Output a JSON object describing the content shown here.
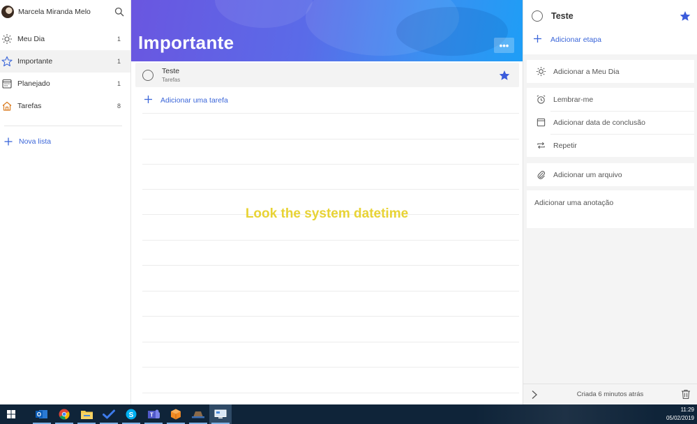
{
  "sidebar": {
    "user_name": "Marcela Miranda Melo",
    "items": [
      {
        "label": "Meu Dia",
        "count": "1",
        "icon": "sun-icon"
      },
      {
        "label": "Importante",
        "count": "1",
        "icon": "star-outline-icon"
      },
      {
        "label": "Planejado",
        "count": "1",
        "icon": "calendar-icon"
      },
      {
        "label": "Tarefas",
        "count": "8",
        "icon": "home-icon"
      }
    ],
    "new_list_label": "Nova lista"
  },
  "main": {
    "title": "Importante",
    "more_label": "•••",
    "task": {
      "title": "Teste",
      "list": "Tarefas",
      "starred": true
    },
    "add_task_label": "Adicionar uma tarefa",
    "overlay_text": "Look the system datetime"
  },
  "details": {
    "title": "Teste",
    "add_step_label": "Adicionar etapa",
    "add_my_day_label": "Adicionar a Meu Dia",
    "remind_label": "Lembrar-me",
    "due_date_label": "Adicionar data de conclusão",
    "repeat_label": "Repetir",
    "add_file_label": "Adicionar um arquivo",
    "note_placeholder": "Adicionar uma anotação",
    "created_label": "Criada 6 minutos atrás"
  },
  "taskbar": {
    "time": "11:29",
    "date": "05/02/2019"
  },
  "colors": {
    "accent": "#3b66d9",
    "star": "#3b5cdb",
    "overlay": "#e8d335",
    "taskbar": "#0f2439"
  }
}
